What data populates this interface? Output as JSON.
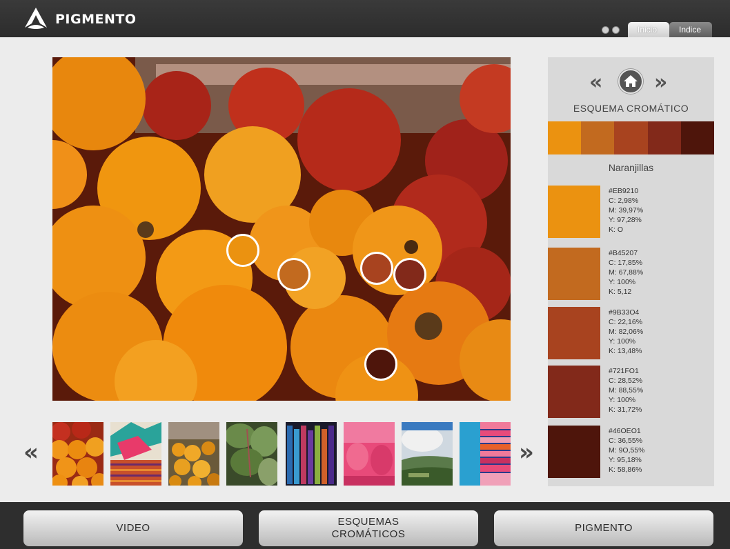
{
  "header": {
    "brand": "PIGMENTO",
    "tabs": [
      {
        "label": "Inicio"
      },
      {
        "label": "Indice"
      }
    ]
  },
  "panel": {
    "title": "ESQUEMA CROMÁTICO",
    "subtitle": "Naranjillas",
    "colors": [
      {
        "hex": "#EB9210",
        "fill": "#EB9210",
        "c": "C: 2,98%",
        "m": "M: 39,97%",
        "y": "Y: 97,28%",
        "k": "K: O"
      },
      {
        "hex": "#B45207",
        "fill": "#C26A1F",
        "c": "C: 17,85%",
        "m": "M: 67,88%",
        "y": "Y: 100%",
        "k": "K: 5,12"
      },
      {
        "hex": "#9B33O4",
        "fill": "#A8431F",
        "c": "C: 22,16%",
        "m": "M: 82,06%",
        "y": "Y: 100%",
        "k": "K: 13,48%"
      },
      {
        "hex": "#721FO1",
        "fill": "#82291A",
        "c": "C: 28,52%",
        "m": "M: 88,55%",
        "y": "Y: 100%",
        "k": "K: 31,72%"
      },
      {
        "hex": "#46OEO1",
        "fill": "#4E150B",
        "c": "C: 36,55%",
        "m": "M: 9O,55%",
        "y": "Y: 95,18%",
        "k": "K: 58,86%"
      }
    ]
  },
  "thumbnails": [
    {
      "name": "naranjillas"
    },
    {
      "name": "tejido-floral"
    },
    {
      "name": "flores-naranjas"
    },
    {
      "name": "hojas-verdes"
    },
    {
      "name": "hilos-colores"
    },
    {
      "name": "lana-rosa"
    },
    {
      "name": "paisaje-andino"
    },
    {
      "name": "tela-multicolor"
    }
  ],
  "footer": {
    "video": "VIDEO",
    "esquemas": "ESQUEMAS\nCROMÁTICOS",
    "pigmento": "PIGMENTO"
  }
}
